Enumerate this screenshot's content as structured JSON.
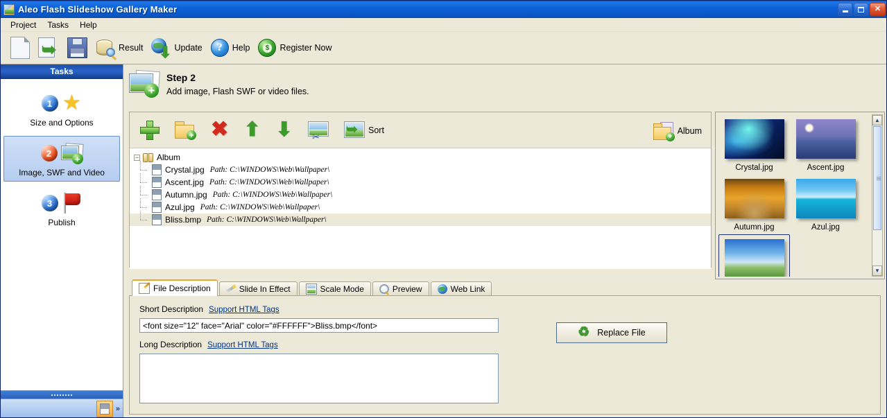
{
  "window": {
    "title": "Aleo Flash Slideshow Gallery Maker",
    "app_icon": "app-image-icon",
    "minimize": "_",
    "maximize": "□",
    "close": "✕"
  },
  "menu": {
    "items": [
      {
        "label": "Project"
      },
      {
        "label": "Tasks"
      },
      {
        "label": "Help"
      }
    ]
  },
  "toolbar": {
    "items": [
      {
        "icon": "new-document-icon",
        "label": ""
      },
      {
        "icon": "open-project-icon",
        "label": ""
      },
      {
        "icon": "save-icon",
        "label": ""
      },
      {
        "icon": "result-database-icon",
        "label": "Result"
      },
      {
        "icon": "update-globe-icon",
        "label": "Update"
      },
      {
        "icon": "help-question-icon",
        "label": "Help"
      },
      {
        "icon": "register-money-icon",
        "label": "Register Now"
      }
    ]
  },
  "sidebar": {
    "header": "Tasks",
    "tasks": [
      {
        "num": "1",
        "label": "Size and Options",
        "icon": "star-icon",
        "selected": false
      },
      {
        "num": "2",
        "label": "Image, SWF and Video",
        "icon": "add-image-icon",
        "selected": true
      },
      {
        "num": "3",
        "label": "Publish",
        "icon": "flag-icon",
        "selected": false
      }
    ],
    "bottom": {
      "doc_button_icon": "document-icon",
      "chevron": "»"
    }
  },
  "step": {
    "title": "Step 2",
    "subtitle": "Add image, Flash SWF or video files.",
    "icon": "add-image-large-icon"
  },
  "list_toolbar": {
    "buttons": [
      {
        "name": "add-file-button",
        "icon": "plus-icon",
        "label": ""
      },
      {
        "name": "add-folder-button",
        "icon": "folder-add-icon",
        "label": ""
      },
      {
        "name": "delete-button",
        "icon": "delete-x-icon",
        "label": ""
      },
      {
        "name": "move-up-button",
        "icon": "arrow-up-icon",
        "label": ""
      },
      {
        "name": "move-down-button",
        "icon": "arrow-down-icon",
        "label": ""
      },
      {
        "name": "crop-image-button",
        "icon": "image-scissors-icon",
        "label": ""
      },
      {
        "name": "sort-button",
        "icon": "sort-image-icon",
        "label": "Sort"
      }
    ],
    "album_button": {
      "label": "Album",
      "icon": "folder-album-add-icon"
    }
  },
  "file_tree": {
    "expander": "−",
    "root": {
      "label": "Album",
      "icon": "album-book-icon"
    },
    "path_prefix": "Path:",
    "files": [
      {
        "name": "Crystal.jpg",
        "path": "C:\\WINDOWS\\Web\\Wallpaper\\",
        "selected": false
      },
      {
        "name": "Ascent.jpg",
        "path": "C:\\WINDOWS\\Web\\Wallpaper\\",
        "selected": false
      },
      {
        "name": "Autumn.jpg",
        "path": "C:\\WINDOWS\\Web\\Wallpaper\\",
        "selected": false
      },
      {
        "name": "Azul.jpg",
        "path": "C:\\WINDOWS\\Web\\Wallpaper\\",
        "selected": false
      },
      {
        "name": "Bliss.bmp",
        "path": "C:\\WINDOWS\\Web\\Wallpaper\\",
        "selected": true
      }
    ]
  },
  "thumbnails": {
    "items": [
      {
        "label": "Crystal.jpg",
        "theme": "thumb-crystal",
        "selected": false
      },
      {
        "label": "Ascent.jpg",
        "theme": "thumb-ascent",
        "selected": false
      },
      {
        "label": "Autumn.jpg",
        "theme": "thumb-autumn",
        "selected": false
      },
      {
        "label": "Azul.jpg",
        "theme": "thumb-azul",
        "selected": false
      },
      {
        "label": "",
        "theme": "thumb-bliss",
        "selected": true
      }
    ],
    "scroll_up": "▲",
    "scroll_down": "▼"
  },
  "tabs": [
    {
      "label": "File Description",
      "icon": "file-description-icon",
      "active": true
    },
    {
      "label": "Slide In Effect",
      "icon": "magic-wand-icon",
      "active": false
    },
    {
      "label": "Scale Mode",
      "icon": "scale-mode-icon",
      "active": false
    },
    {
      "label": "Preview",
      "icon": "preview-magnifier-icon",
      "active": false
    },
    {
      "label": "Web Link",
      "icon": "web-link-globe-icon",
      "active": false
    }
  ],
  "file_description": {
    "short_label": "Short Description",
    "short_link": "Support HTML Tags",
    "short_value": "<font size=\"12\" face=\"Arial\" color=\"#FFFFFF\">Bliss.bmp</font>",
    "short_placeholder": "",
    "long_label": "Long Description",
    "long_link": "Support HTML Tags",
    "long_value": "",
    "long_placeholder": "",
    "replace_button": "Replace File",
    "replace_icon": "recycle-icon"
  },
  "colors": {
    "titlebar_blue": "#0a55c4",
    "window_bg": "#ece9d8",
    "sidebar_header": "#1d4fa8",
    "selection": "#b6cdf0",
    "active_tab_accent": "#f0a52b",
    "link": "#00338c"
  }
}
